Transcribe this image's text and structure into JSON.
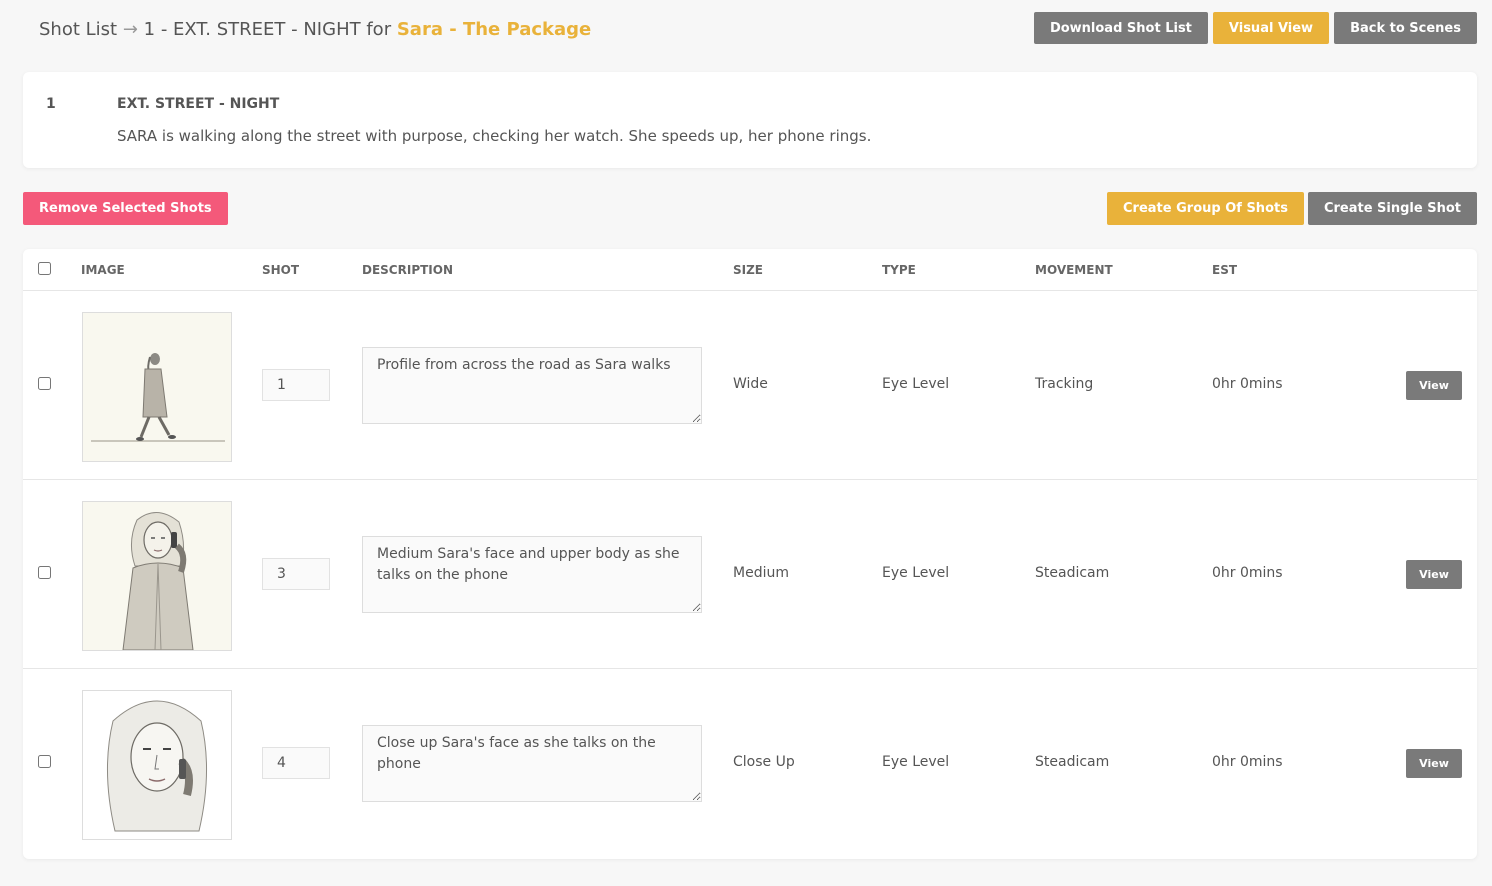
{
  "header": {
    "breadcrumb_root": "Shot List",
    "arrow": "→",
    "scene_title": "1 - EXT. STREET - NIGHT",
    "for_word": "for",
    "project": "Sara - The Package"
  },
  "actions": {
    "download": "Download Shot List",
    "visual_view": "Visual View",
    "back": "Back to Scenes",
    "remove": "Remove Selected Shots",
    "create_group": "Create Group Of Shots",
    "create_single": "Create Single Shot"
  },
  "scene": {
    "number": "1",
    "heading": "EXT. STREET - NIGHT",
    "description": "SARA is walking along the street with purpose, checking her watch. She speeds up, her phone rings."
  },
  "table": {
    "columns": [
      "IMAGE",
      "SHOT",
      "DESCRIPTION",
      "SIZE",
      "TYPE",
      "MOVEMENT",
      "EST"
    ],
    "view_label": "View",
    "rows": [
      {
        "shot": "1",
        "description": "Profile from across the road as Sara walks",
        "size": "Wide",
        "type": "Eye Level",
        "movement": "Tracking",
        "est": "0hr 0mins"
      },
      {
        "shot": "3",
        "description": "Medium Sara's face and upper body as she talks on the phone",
        "size": "Medium",
        "type": "Eye Level",
        "movement": "Steadicam",
        "est": "0hr 0mins"
      },
      {
        "shot": "4",
        "description": "Close up Sara's face as she talks on the phone",
        "size": "Close Up",
        "type": "Eye Level",
        "movement": "Steadicam",
        "est": "0hr 0mins"
      }
    ]
  },
  "colors": {
    "accent": "#e9b23a",
    "danger": "#f4597a",
    "neutral": "#7a7a7a"
  }
}
